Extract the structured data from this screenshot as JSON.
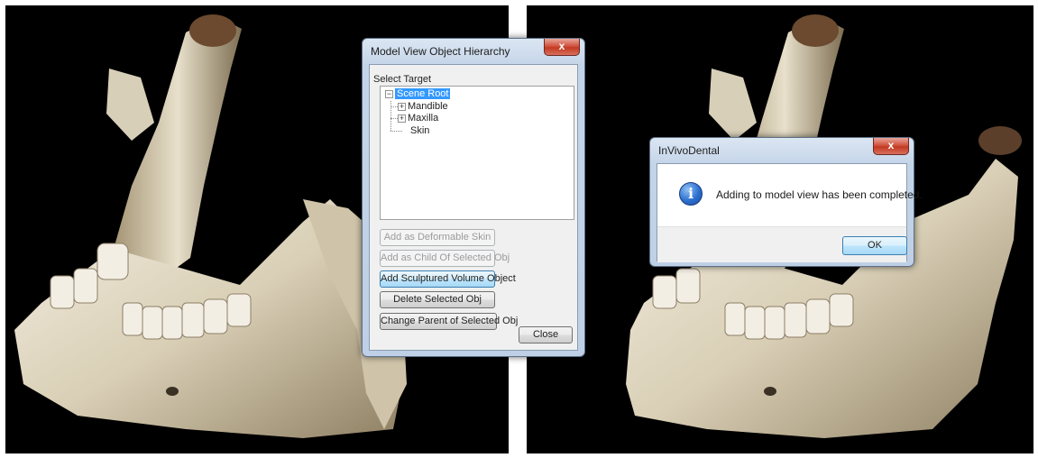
{
  "left_viewport": {
    "content": "3D rendered mandible and maxilla volume"
  },
  "right_viewport": {
    "content": "3D rendered mandible volume"
  },
  "hierarchy_dialog": {
    "title": "Model View Object Hierarchy",
    "close_glyph": "x",
    "select_label": "Select Target",
    "tree": {
      "root": "Scene Root",
      "children": [
        "Mandible",
        "Maxilla",
        "Skin"
      ]
    },
    "buttons": {
      "add_deformable_skin": "Add as Deformable Skin",
      "add_child": "Add as Child Of Selected Obj",
      "add_sculptured": "Add Sculptured Volume Object",
      "delete_selected": "Delete Selected Obj",
      "change_parent": "Change Parent of Selected Obj",
      "close": "Close"
    }
  },
  "message_box": {
    "title": "InVivoDental",
    "close_glyph": "x",
    "icon": "information-icon",
    "icon_glyph": "i",
    "message": "Adding to model view has been completed.",
    "ok_label": "OK"
  },
  "colors": {
    "viewport_bg": "#000000",
    "bone_light": "#efe9d8",
    "bone_dark": "#6e5f45",
    "selection": "#3399ff"
  }
}
